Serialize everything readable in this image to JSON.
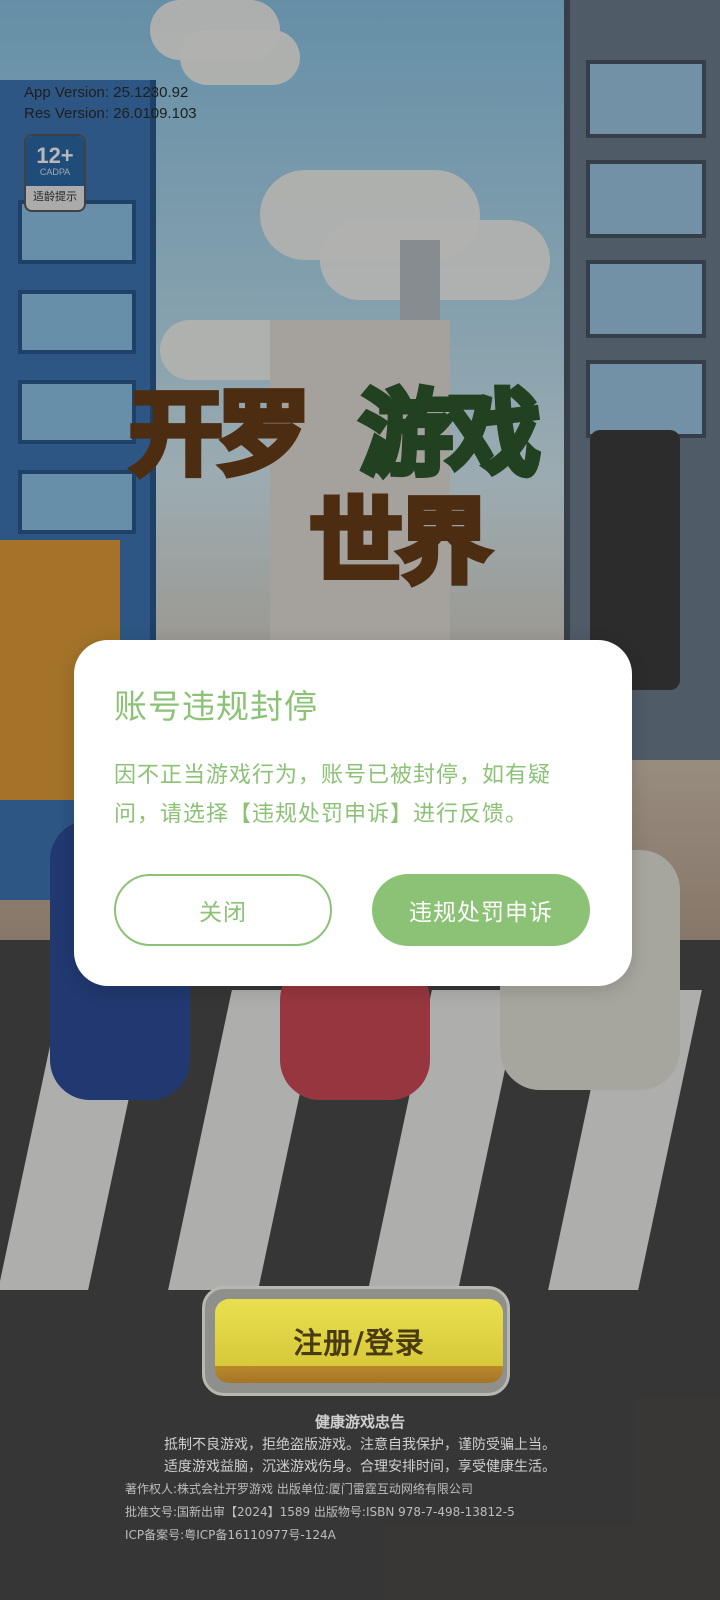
{
  "version": {
    "app": "App Version: 25.1230.92",
    "res": "Res Version: 26.0109.103"
  },
  "age_rating": {
    "number": "12+",
    "org": "CADPA",
    "label": "适龄提示"
  },
  "game_title": {
    "line1a": "开罗",
    "line1b": "游戏",
    "line2": "世界"
  },
  "dialog": {
    "title": "账号违规封停",
    "message": "因不正当游戏行为，账号已被封停，如有疑问，请选择【违规处罚申诉】进行反馈。",
    "close_label": "关闭",
    "appeal_label": "违规处罚申诉"
  },
  "login": {
    "label": "注册/登录"
  },
  "footer": {
    "heading": "健康游戏忠告",
    "line1": "抵制不良游戏，拒绝盗版游戏。注意自我保护，谨防受骗上当。",
    "line2": "适度游戏益脑，沉迷游戏伤身。合理安排时间，享受健康生活。",
    "copyright": "著作权人:株式会社开罗游戏 出版单位:厦门雷霆互动网络有限公司",
    "approval": "批准文号:国新出审【2024】1589     出版物号:ISBN 978-7-498-13812-5",
    "icp": "ICP备案号:粤ICP备16110977号-124A"
  },
  "colors": {
    "accent_green": "#8cc276",
    "login_yellow": "#e9e04e"
  }
}
